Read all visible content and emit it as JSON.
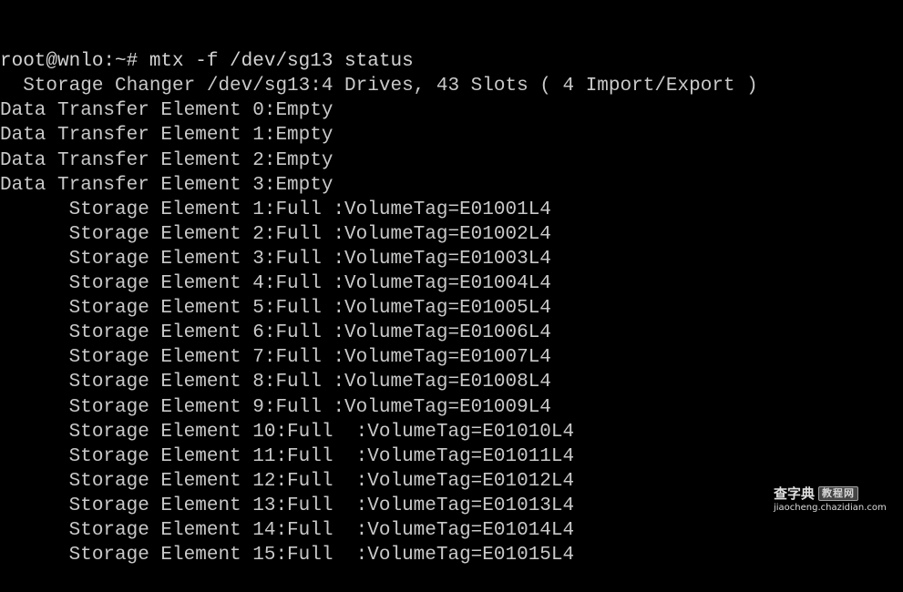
{
  "terminal": {
    "background_color": "#000000",
    "text_color": "#c9c9c9",
    "lines": [
      "root@wnlo:~# mtx -f /dev/sg13 status",
      "  Storage Changer /dev/sg13:4 Drives, 43 Slots ( 4 Import/Export )",
      "Data Transfer Element 0:Empty",
      "Data Transfer Element 1:Empty",
      "Data Transfer Element 2:Empty",
      "Data Transfer Element 3:Empty",
      "      Storage Element 1:Full :VolumeTag=E01001L4",
      "      Storage Element 2:Full :VolumeTag=E01002L4",
      "      Storage Element 3:Full :VolumeTag=E01003L4",
      "      Storage Element 4:Full :VolumeTag=E01004L4",
      "      Storage Element 5:Full :VolumeTag=E01005L4",
      "      Storage Element 6:Full :VolumeTag=E01006L4",
      "      Storage Element 7:Full :VolumeTag=E01007L4",
      "      Storage Element 8:Full :VolumeTag=E01008L4",
      "      Storage Element 9:Full :VolumeTag=E01009L4",
      "      Storage Element 10:Full  :VolumeTag=E01010L4",
      "      Storage Element 11:Full  :VolumeTag=E01011L4",
      "      Storage Element 12:Full  :VolumeTag=E01012L4",
      "      Storage Element 13:Full  :VolumeTag=E01013L4",
      "      Storage Element 14:Full  :VolumeTag=E01014L4",
      "      Storage Element 15:Full  :VolumeTag=E01015L4"
    ],
    "prompt": {
      "user": "root",
      "host": "wnlo",
      "cwd": "~",
      "symbol": "#",
      "command": "mtx -f /dev/sg13 status"
    },
    "changer": {
      "device": "/dev/sg13",
      "drives": 4,
      "slots": 43,
      "import_export": 4
    },
    "drives": [
      {
        "index": 0,
        "state": "Empty"
      },
      {
        "index": 1,
        "state": "Empty"
      },
      {
        "index": 2,
        "state": "Empty"
      },
      {
        "index": 3,
        "state": "Empty"
      }
    ],
    "slots_list": [
      {
        "index": 1,
        "state": "Full",
        "volume_tag": "E01001L4"
      },
      {
        "index": 2,
        "state": "Full",
        "volume_tag": "E01002L4"
      },
      {
        "index": 3,
        "state": "Full",
        "volume_tag": "E01003L4"
      },
      {
        "index": 4,
        "state": "Full",
        "volume_tag": "E01004L4"
      },
      {
        "index": 5,
        "state": "Full",
        "volume_tag": "E01005L4"
      },
      {
        "index": 6,
        "state": "Full",
        "volume_tag": "E01006L4"
      },
      {
        "index": 7,
        "state": "Full",
        "volume_tag": "E01007L4"
      },
      {
        "index": 8,
        "state": "Full",
        "volume_tag": "E01008L4"
      },
      {
        "index": 9,
        "state": "Full",
        "volume_tag": "E01009L4"
      },
      {
        "index": 10,
        "state": "Full",
        "volume_tag": "E01010L4"
      },
      {
        "index": 11,
        "state": "Full",
        "volume_tag": "E01011L4"
      },
      {
        "index": 12,
        "state": "Full",
        "volume_tag": "E01012L4"
      },
      {
        "index": 13,
        "state": "Full",
        "volume_tag": "E01013L4"
      },
      {
        "index": 14,
        "state": "Full",
        "volume_tag": "E01014L4"
      },
      {
        "index": 15,
        "state": "Full",
        "volume_tag": "E01015L4"
      }
    ]
  },
  "watermark": {
    "cn_title": "查字典",
    "cn_badge": "教程网",
    "url": "jiaocheng.chazidian.com"
  }
}
